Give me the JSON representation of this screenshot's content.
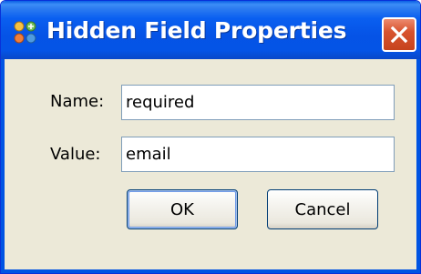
{
  "window": {
    "title": "Hidden Field Properties",
    "icon": "app-icon",
    "close_icon": "close-icon"
  },
  "form": {
    "name_label": "Name:",
    "name_value": "required",
    "value_label": "Value:",
    "value_value": "email"
  },
  "buttons": {
    "ok_label": "OK",
    "cancel_label": "Cancel"
  },
  "colors": {
    "titlebar": "#0a5ff0",
    "close_button": "#d8532f",
    "dialog_background": "#ece9d8",
    "field_border": "#7f9db9"
  }
}
